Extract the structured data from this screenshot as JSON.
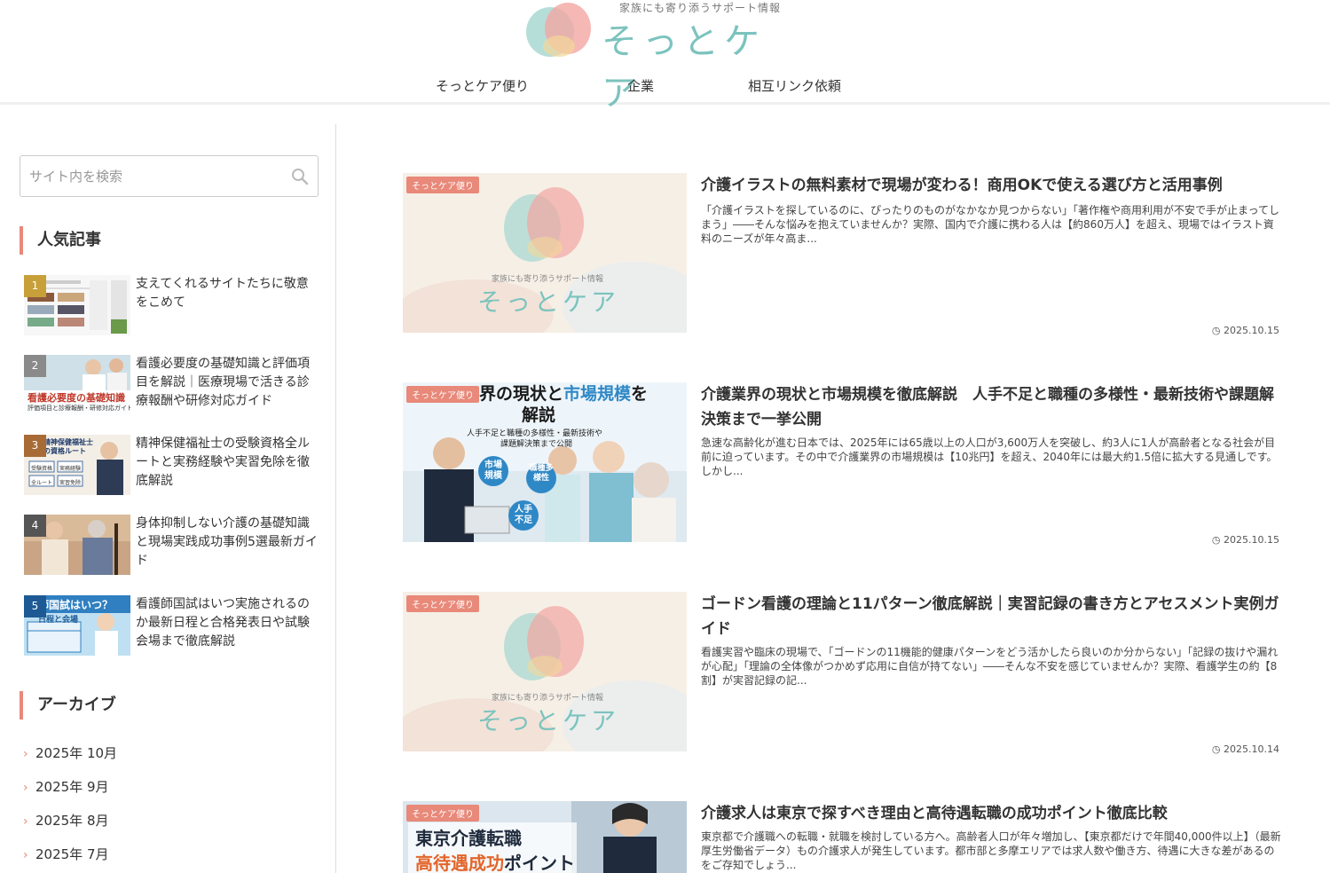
{
  "header": {
    "tagline": "家族にも寄り添うサポート情報",
    "logo_text": "そっとケア",
    "nav": [
      "そっとケア便り",
      "企業",
      "相互リンク依頼"
    ]
  },
  "sidebar": {
    "search_placeholder": "サイト内を検索",
    "popular_title": "人気記事",
    "popular": [
      {
        "rank": "1",
        "title": "支えてくれるサイトたちに敬意をこめて"
      },
      {
        "rank": "2",
        "title": "看護必要度の基礎知識と評価項目を解説｜医療現場で活きる診療報酬や研修対応ガイド"
      },
      {
        "rank": "3",
        "title": "精神保健福祉士の受験資格全ルートと実務経験や実習免除を徹底解説"
      },
      {
        "rank": "4",
        "title": "身体抑制しない介護の基礎知識と現場実践成功事例5選最新ガイド"
      },
      {
        "rank": "5",
        "title": "看護師国試はいつ実施されるのか最新日程と合格発表日や試験会場まで徹底解説"
      }
    ],
    "thumb_text": {
      "t2_main": "看護必要度の基礎知識",
      "t2_sub": "評価項目と診療報酬・研修対応ガイド",
      "t3_main": "精神保健福祉士の資格ルート",
      "t3_boxes": [
        "受験資格",
        "実務経験",
        "全ルート",
        "実習免除"
      ],
      "t5_main": "師国試はいつ？",
      "t5_sub": "日程と会場"
    },
    "archive_title": "アーカイブ",
    "archive": [
      "2025年 10月",
      "2025年 9月",
      "2025年 8月",
      "2025年 7月"
    ]
  },
  "posts": [
    {
      "category": "そっとケア便り",
      "title": "介護イラストの無料素材で現場が変わる！商用OKで使える選び方と活用事例",
      "excerpt": "「介護イラストを探しているのに、ぴったりのものがなかなか見つからない」「著作権や商用利用が不安で手が止まってしまう」――そんな悩みを抱えていませんか？実際、国内で介護に携わる人は【約860万人】を超え、現場ではイラスト資料のニーズが年々高ま...",
      "date": "2025.10.15"
    },
    {
      "category": "そっとケア便り",
      "title": "介護業界の現状と市場規模を徹底解説　人手不足と職種の多様性・最新技術や課題解決策まで一挙公開",
      "excerpt": "急速な高齢化が進む日本では、2025年には65歳以上の人口が3,600万人を突破し、約3人に1人が高齢者となる社会が目前に迫っています。その中で介護業界の市場規模は【10兆円】を超え、2040年には最大約1.5倍に拡大する見通しです。しかし...",
      "date": "2025.10.15"
    },
    {
      "category": "そっとケア便り",
      "title": "ゴードン看護の理論と11パターン徹底解説｜実習記録の書き方とアセスメント実例ガイド",
      "excerpt": "看護実習や臨床の現場で、「ゴードンの11機能的健康パターンをどう活かしたら良いのか分からない」「記録の抜けや漏れが心配」「理論の全体像がつかめず応用に自信が持てない」――そんな不安を感じていませんか？実際、看護学生の約【8割】が実習記録の記...",
      "date": "2025.10.14"
    },
    {
      "category": "そっとケア便り",
      "title": "介護求人は東京で探すべき理由と高待遇転職の成功ポイント徹底比較",
      "excerpt": "東京都で介護職への転職・就職を検討している方へ。高齢者人口が年々増加し、【東京都だけで年間40,000件以上】（最新厚生労働省データ）もの介護求人が発生しています。都市部と多摩エリアでは求人数や働き方、待遇に大きな差があるのをご存知でしょう...",
      "date": ""
    }
  ],
  "thumb2": {
    "headline1": "界の現状と",
    "headline2": "市場規模",
    "headline3": "を",
    "headline4": "解説",
    "sub1": "人手不足と職種の多様性・最新技術や",
    "sub2": "課題解決策まで公開",
    "badges": [
      "市場規模",
      "職種多様性",
      "人手不足"
    ]
  },
  "thumb4": {
    "line1": "東京介護転職",
    "line2a": "高待遇成功",
    "line2b": "ポイント"
  },
  "colors": {
    "accent": "#e8897a",
    "logo": "#7cc3be"
  }
}
